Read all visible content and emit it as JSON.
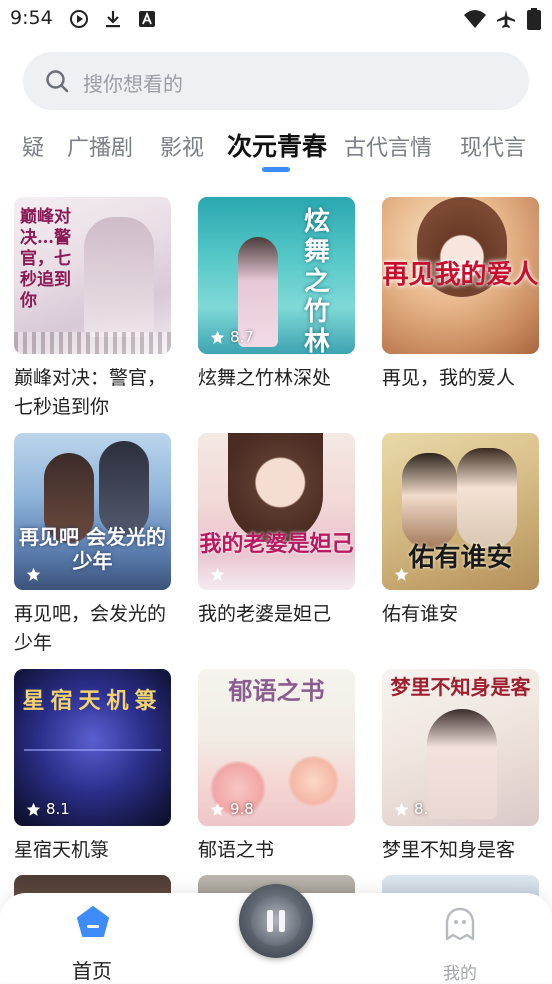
{
  "status_bar": {
    "time": "9:54"
  },
  "search": {
    "placeholder": "搜你想看的"
  },
  "tabs": [
    {
      "label": "疑"
    },
    {
      "label": "广播剧"
    },
    {
      "label": "影视"
    },
    {
      "label": "次元青春",
      "active": true
    },
    {
      "label": "古代言情"
    },
    {
      "label": "现代言"
    }
  ],
  "books": [
    {
      "title": "巅峰对决：警官，七秒追到你",
      "cover_text": "巅峰对决…警官，七秒追到你",
      "rating": ""
    },
    {
      "title": "炫舞之竹林深处",
      "cover_text": "炫舞之竹林深处",
      "rating": "8.7"
    },
    {
      "title": "再见，我的爱人",
      "cover_text": "再见我的爱人",
      "rating": ""
    },
    {
      "title": "再见吧，会发光的少年",
      "cover_text": "再见吧 会发光的少年",
      "rating": ""
    },
    {
      "title": "我的老婆是妲己",
      "cover_text": "我的老婆是妲己",
      "rating": ""
    },
    {
      "title": "佑有谁安",
      "cover_text": "佑有谁安",
      "rating": ""
    },
    {
      "title": "星宿天机箓",
      "cover_text": "星宿天机箓",
      "rating": "8.1"
    },
    {
      "title": "郁语之书",
      "cover_text": "郁语之书",
      "rating": "9.8"
    },
    {
      "title": "梦里不知身是客",
      "cover_text": "梦里不知身是客",
      "rating": "8."
    }
  ],
  "bottom_nav": {
    "home_label": "首页",
    "mine_label": "我的"
  },
  "colors": {
    "accent": "#3e8cf7",
    "tab_inactive": "#7b7f87",
    "search_bg": "#eef0f3"
  }
}
